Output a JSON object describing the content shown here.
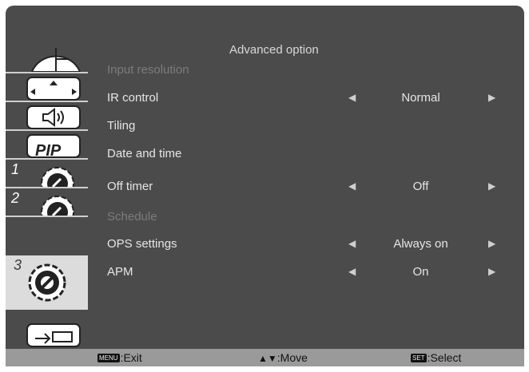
{
  "menu": {
    "title": "Advanced option",
    "items": [
      {
        "label": "Input resolution",
        "enabled": false,
        "value": "",
        "has_arrows": false
      },
      {
        "label": "IR control",
        "enabled": true,
        "value": "Normal",
        "has_arrows": true
      },
      {
        "label": "Tiling",
        "enabled": true,
        "value": "",
        "has_arrows": false
      },
      {
        "label": "Date and time",
        "enabled": true,
        "value": "",
        "has_arrows": false
      },
      {
        "label": "Off timer",
        "enabled": true,
        "value": "Off",
        "has_arrows": true
      },
      {
        "label": "Schedule",
        "enabled": false,
        "value": "",
        "has_arrows": false
      },
      {
        "label": "OPS settings",
        "enabled": true,
        "value": "Always on",
        "has_arrows": true
      },
      {
        "label": "APM",
        "enabled": true,
        "value": "On",
        "has_arrows": true
      }
    ]
  },
  "sidebar": {
    "tabs": [
      {
        "icon": "picture-icon",
        "number": ""
      },
      {
        "icon": "screen-position-icon",
        "number": ""
      },
      {
        "icon": "audio-icon",
        "number": ""
      },
      {
        "icon": "pip-icon",
        "number": "",
        "label": "PIP"
      },
      {
        "icon": "settings-icon",
        "number": "1"
      },
      {
        "icon": "settings-icon",
        "number": "2"
      },
      {
        "icon": "settings-icon",
        "number": "3",
        "selected": true
      },
      {
        "icon": "input-icon",
        "number": ""
      }
    ]
  },
  "footer": {
    "exit_key": "MENU",
    "exit_label": ":Exit",
    "move_key": "▲▼",
    "move_label": ":Move",
    "select_key": "SET",
    "select_label": ":Select"
  },
  "colors": {
    "background": "#4b4b4b",
    "text": "#e6e6e6",
    "disabled_text": "#7c7c7c",
    "footer": "#9a9a9a",
    "selected_tab": "#dcdcdc"
  }
}
